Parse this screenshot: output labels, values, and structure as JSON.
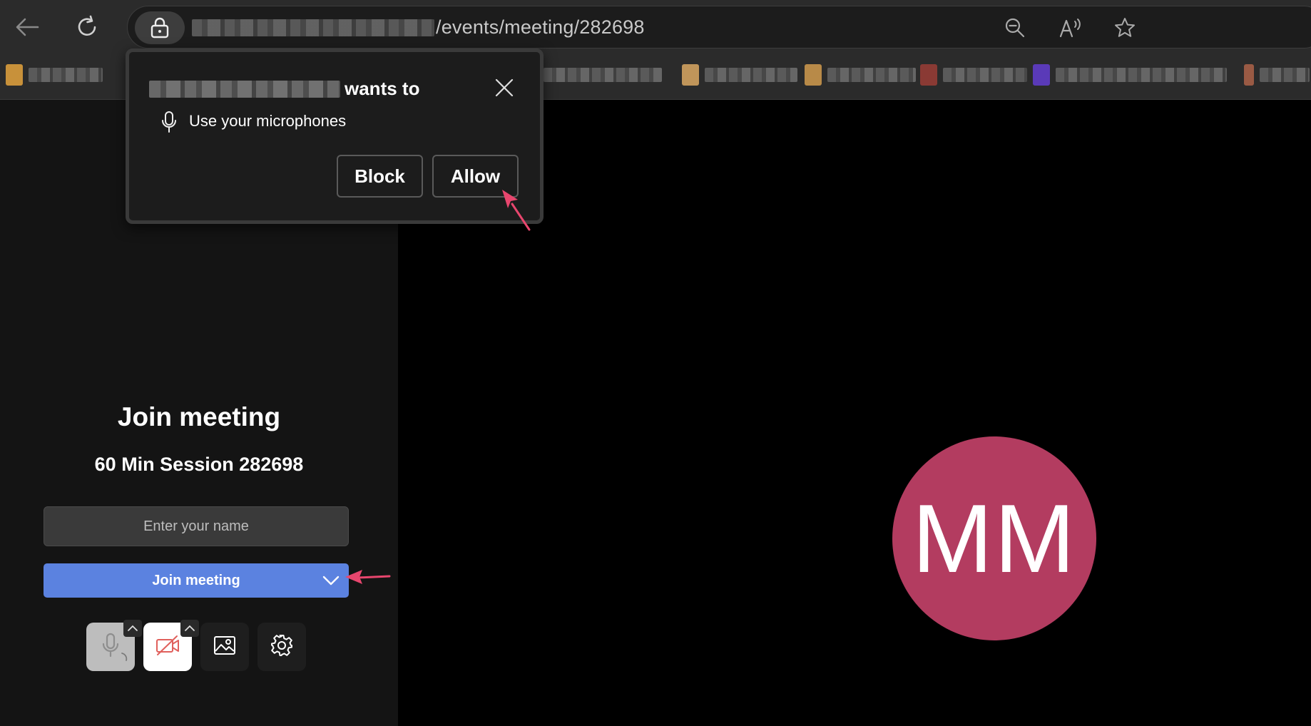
{
  "browser": {
    "url_visible": "/events/meeting/282698",
    "icons": {
      "back": "back-arrow-icon",
      "reload": "reload-icon",
      "lock": "lock-icon",
      "zoom": "zoom-out-icon",
      "read_aloud": "read-aloud-icon",
      "favorite": "star-icon"
    }
  },
  "permission_popup": {
    "wants_to": "wants to",
    "request": "Use your microphones",
    "block_label": "Block",
    "allow_label": "Allow",
    "icons": {
      "close": "close-icon",
      "microphone": "microphone-icon"
    }
  },
  "join_panel": {
    "title": "Join meeting",
    "session": "60 Min Session 282698",
    "name_placeholder": "Enter your name",
    "join_button_label": "Join meeting",
    "controls": [
      "microphone-icon",
      "camera-off-icon",
      "background-image-icon",
      "gear-icon"
    ]
  },
  "video": {
    "avatar_initials": "MM",
    "avatar_color": "#b33c60"
  },
  "colors": {
    "accent": "#5b82e0",
    "annotation_arrow": "#e8466e"
  }
}
